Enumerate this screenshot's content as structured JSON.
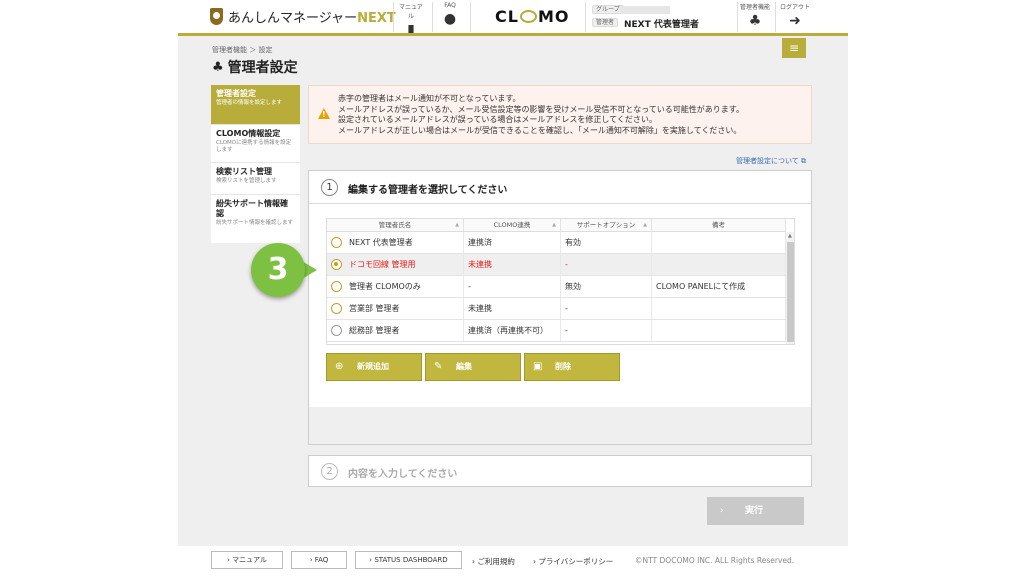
{
  "header": {
    "app_name_prefix": "あんしんマネージャー",
    "app_name_suffix": "NEXT",
    "manual_label": "マニュアル",
    "faq_label": "FAQ",
    "brand": "CLOMO",
    "group_label": "グループ",
    "admin_label": "管理者",
    "admin_name": "NEXT 代表管理者",
    "admin_func_label": "管理者機能",
    "logout_label": "ログアウト",
    "accent_color": "#b8ad3a"
  },
  "breadcrumb": "管理者機能 ＞ 設定",
  "page_title": "管理者設定",
  "sidebar": {
    "items": [
      {
        "label": "管理者設定",
        "sub": "管理者の情報を設定します",
        "active": true
      },
      {
        "label": "CLOMO情報設定",
        "sub": "CLOMOに連携する情報を設定します",
        "active": false
      },
      {
        "label": "検索リスト管理",
        "sub": "検索リストを管理します",
        "active": false
      },
      {
        "label": "紛失サポート情報確認",
        "sub": "紛失サポート情報を確認します",
        "active": false
      }
    ]
  },
  "alert": {
    "lines": [
      "赤字の管理者はメール通知が不可となっています。",
      "メールアドレスが誤っているか、メール受信設定等の影響を受けメール受信不可となっている可能性があります。",
      "設定されているメールアドレスが誤っている場合はメールアドレスを修正してください。",
      "メールアドレスが正しい場合はメールが受信できることを確認し、「メール通知不可解除」を実施してください。"
    ]
  },
  "help_link": "管理者設定について",
  "step1": {
    "num": "1",
    "title": "編集する管理者を選択してください"
  },
  "table": {
    "headers": [
      "管理者氏名",
      "CLOMO連携",
      "サポートオプション",
      "備考"
    ],
    "rows": [
      {
        "name": "NEXT 代表管理者",
        "clomo": "連携済",
        "support": "有効",
        "note": "",
        "selected": false
      },
      {
        "name": "ドコモ回線 管理用",
        "clomo": "未連携",
        "support": "-",
        "note": "",
        "selected": true
      },
      {
        "name": "管理者 CLOMOのみ",
        "clomo": "-",
        "support": "無効",
        "note": "CLOMO PANELにて作成",
        "selected": false
      },
      {
        "name": "営業部 管理者",
        "clomo": "未連携",
        "support": "-",
        "note": "",
        "selected": false
      },
      {
        "name": "総務部 管理者",
        "clomo": "連携済（再連携不可）",
        "support": "-",
        "note": "",
        "selected": false
      }
    ]
  },
  "buttons": {
    "add": "新規追加",
    "edit": "編集",
    "delete": "削除",
    "execute": "実行"
  },
  "step_badge": "3",
  "step2": {
    "num": "2",
    "title": "内容を入力してください"
  },
  "footer": {
    "manual": "マニュアル",
    "faq": "FAQ",
    "status": "STATUS DASHBOARD",
    "terms": "ご利用規約",
    "privacy": "プライバシーポリシー",
    "copyright": "©NTT DOCOMO INC. ALL Rights Reserved."
  }
}
